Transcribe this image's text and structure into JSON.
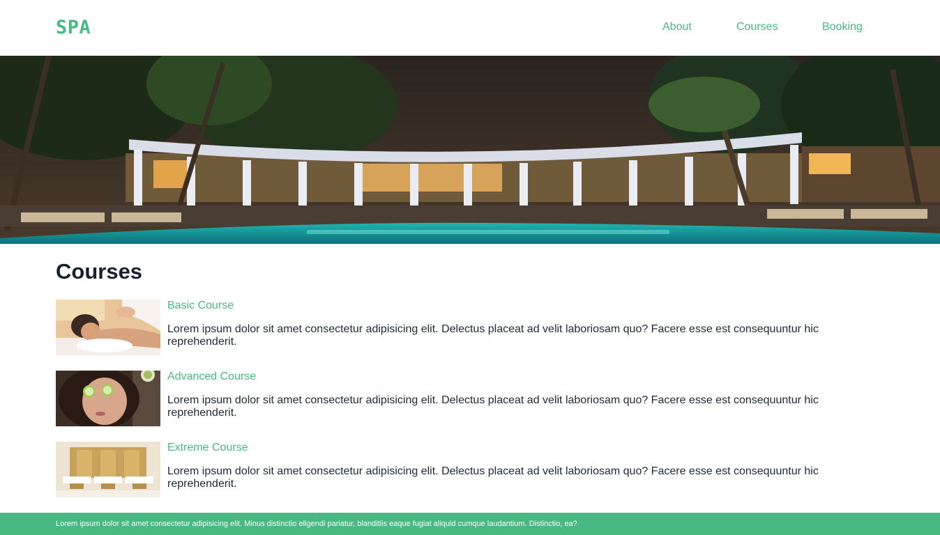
{
  "header": {
    "logo": "SPA",
    "nav": [
      {
        "label": "About"
      },
      {
        "label": "Courses"
      },
      {
        "label": "Booking"
      }
    ]
  },
  "colors": {
    "accent": "#48b983",
    "heading": "#17202e",
    "text": "#1f2937"
  },
  "main": {
    "title": "Courses",
    "courses": [
      {
        "name": "Basic Course",
        "description": "Lorem ipsum dolor sit amet consectetur adipisicing elit. Delectus placeat ad velit laboriosam quo? Facere esse est consequuntur hic reprehenderit."
      },
      {
        "name": "Advanced Course",
        "description": "Lorem ipsum dolor sit amet consectetur adipisicing elit. Delectus placeat ad velit laboriosam quo? Facere esse est consequuntur hic reprehenderit."
      },
      {
        "name": "Extreme Course",
        "description": "Lorem ipsum dolor sit amet consectetur adipisicing elit. Delectus placeat ad velit laboriosam quo? Facere esse est consequuntur hic reprehenderit."
      }
    ]
  },
  "footer": {
    "text": "Lorem ipsum dolor sit amet consectetur adipisicing elit. Minus distinctio eligendi pariatur, blanditiis eaque fugiat aliquid cumque laudantium. Distinctio, ea?"
  }
}
